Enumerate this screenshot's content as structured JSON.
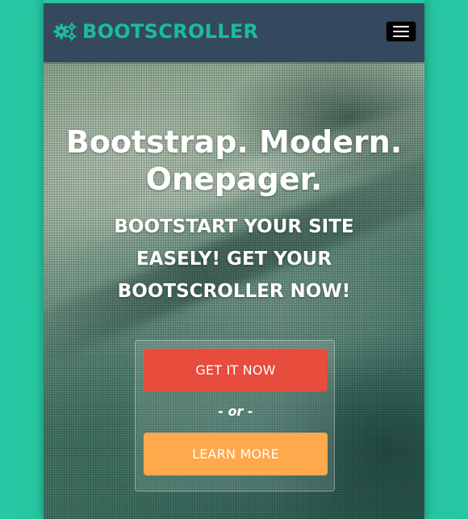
{
  "navbar": {
    "brand_text": "BOOTSCROLLER",
    "brand_icon": "gears-icon",
    "menu_toggle_icon": "hamburger-menu-icon"
  },
  "hero": {
    "headline": "Bootstrap. Modern. Onepager.",
    "subheadline": "BOOTSTART YOUR SITE EASELY! GET YOUR BOOTSCROLLER NOW!",
    "primary_button_label": "GET IT NOW",
    "separator_text": "- or -",
    "secondary_button_label": "LEARN MORE"
  },
  "colors": {
    "navbar_bg": "#34495e",
    "brand_accent": "#1abc9c",
    "primary_button": "#e74c3c",
    "secondary_button": "#ffa84c"
  }
}
